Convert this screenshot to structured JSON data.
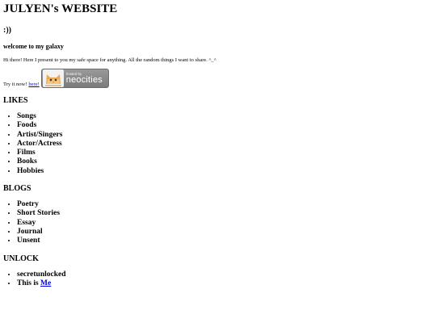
{
  "header": {
    "title": "JULYEN's WEBSITE",
    "smiley": ":))",
    "welcome": "welcome to my galaxy",
    "intro": "Hi there! Here I present to you my safe space for anything. All the random things I want to share. ^_^"
  },
  "try_row": {
    "text": "Try it now!",
    "link_label": "here!",
    "badge_small": "hosted by",
    "badge_big": "neocities"
  },
  "likes": {
    "heading": "LIKES",
    "items": [
      "Songs",
      "Foods",
      "Artist/Singers",
      "Actor/Actress",
      "Films",
      "Books",
      "Hobbies"
    ]
  },
  "blogs": {
    "heading": "BLOGS",
    "items": [
      "Poetry",
      "Short Stories",
      "Essay",
      "Journal",
      "Unsent"
    ]
  },
  "unlock": {
    "heading": "UNLOCK",
    "item1": "secretunlocked",
    "item2_prefix": "This is ",
    "item2_link": "Me"
  },
  "colors": {
    "link": "#0000ee",
    "badge_bg": "#8a8a8a"
  }
}
